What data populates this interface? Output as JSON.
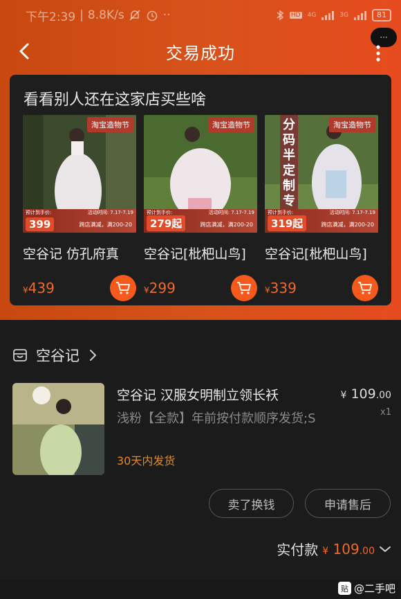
{
  "status_bar": {
    "time": "下午2:39",
    "speed": "8.8K/s",
    "network_1": "HD",
    "network_2": "4G",
    "network_3": "3G",
    "battery": "81"
  },
  "nav": {
    "title": "交易成功",
    "overlay_pill": "···"
  },
  "recommend": {
    "title": "看看别人还在这家店买些啥",
    "items": [
      {
        "badge": "淘宝造物节",
        "activity_time": "活动时间: 7.17-7.19",
        "estimate_label": "预计到手价:",
        "price_tag": "399",
        "promo": "跨店满减，满200-20",
        "name": "空谷记 仿孔府真",
        "currency": "¥",
        "price": "439"
      },
      {
        "badge": "淘宝造物节",
        "activity_time": "活动时间: 7.17-7.19",
        "estimate_label": "预计到手价:",
        "price_tag": "279起",
        "promo": "跨店满减，满200-20",
        "name": "空谷记[枇杷山鸟]",
        "currency": "¥",
        "price": "299"
      },
      {
        "badge": "淘宝造物节",
        "activity_time": "活动时间: 7.17-7.19",
        "estimate_label": "预计到手价:",
        "price_tag": "319起",
        "promo": "跨店满减，满200-20",
        "vertical_banner": "分码半定制专用",
        "name": "空谷记[枇杷山鸟]",
        "currency": "¥",
        "price": "339"
      }
    ]
  },
  "order": {
    "shop_name": "空谷记",
    "product_title": "空谷记 汉服女明制立领长袄",
    "spec": "浅粉【全款】年前按付款顺序发货;S",
    "shipping": "30天内发货",
    "price_currency": "¥",
    "price_int": "109",
    "price_dec": ".00",
    "quantity": "x1",
    "sell_button": "卖了换钱",
    "aftersale_button": "申请售后",
    "paid_label": "实付款",
    "paid_currency": "¥",
    "paid_int": "109",
    "paid_dec": ".00"
  },
  "watermark": {
    "box": "贴",
    "text": "@二手吧"
  },
  "colors": {
    "accent": "#f26a2b",
    "header_gradient_start": "#c8480f",
    "header_gradient_end": "#e64b1f",
    "card_bg": "#1e1e1e",
    "page_bg": "#1b1b1b",
    "shipping": "#e08a2b"
  },
  "icons": {
    "back": "chevron-left-icon",
    "more": "more-vertical-icon",
    "cart": "cart-icon",
    "shop": "store-icon",
    "expand": "chevron-down-icon",
    "shop_arrow": "chevron-right-icon"
  }
}
